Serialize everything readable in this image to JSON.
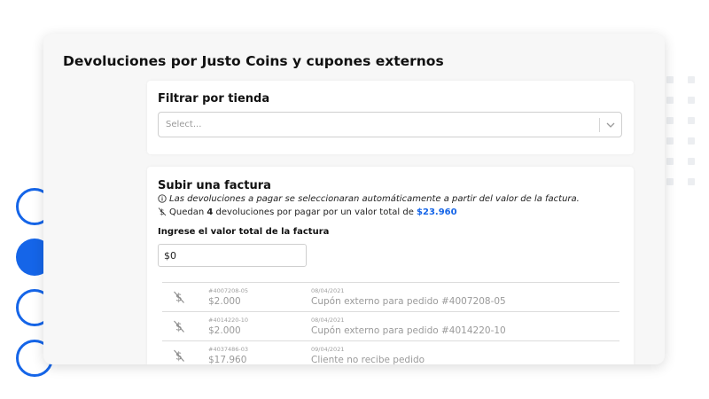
{
  "page_title": "Devoluciones por Justo Coins y cupones externos",
  "filter": {
    "title": "Filtrar por tienda",
    "select_placeholder": "Select..."
  },
  "upload": {
    "title": "Subir una factura",
    "info_text": "Las devoluciones a pagar se seleccionaran automáticamente a partir del valor de la factura.",
    "remaining_prefix": "Quedan",
    "remaining_count": "4",
    "remaining_middle": "devoluciones por pagar por un valor total de",
    "remaining_total": "$23.960",
    "field_label": "Ingrese el valor total de la factura",
    "field_value": "$0"
  },
  "returns": [
    {
      "order_id": "#4007208-05",
      "amount": "$2.000",
      "date": "08/04/2021",
      "description": "Cupón externo para pedido #4007208-05",
      "icon": "dollar-slash-icon"
    },
    {
      "order_id": "#4014220-10",
      "amount": "$2.000",
      "date": "08/04/2021",
      "description": "Cupón externo para pedido #4014220-10",
      "icon": "dollar-slash-icon"
    },
    {
      "order_id": "#4037486-03",
      "amount": "$17.960",
      "date": "09/04/2021",
      "description": "Cliente no recibe pedido",
      "icon": "dollar-slash-icon"
    }
  ],
  "colors": {
    "accent": "#1565e8",
    "card_bg": "#f7f7f7",
    "muted_text": "#9a9a9a"
  }
}
